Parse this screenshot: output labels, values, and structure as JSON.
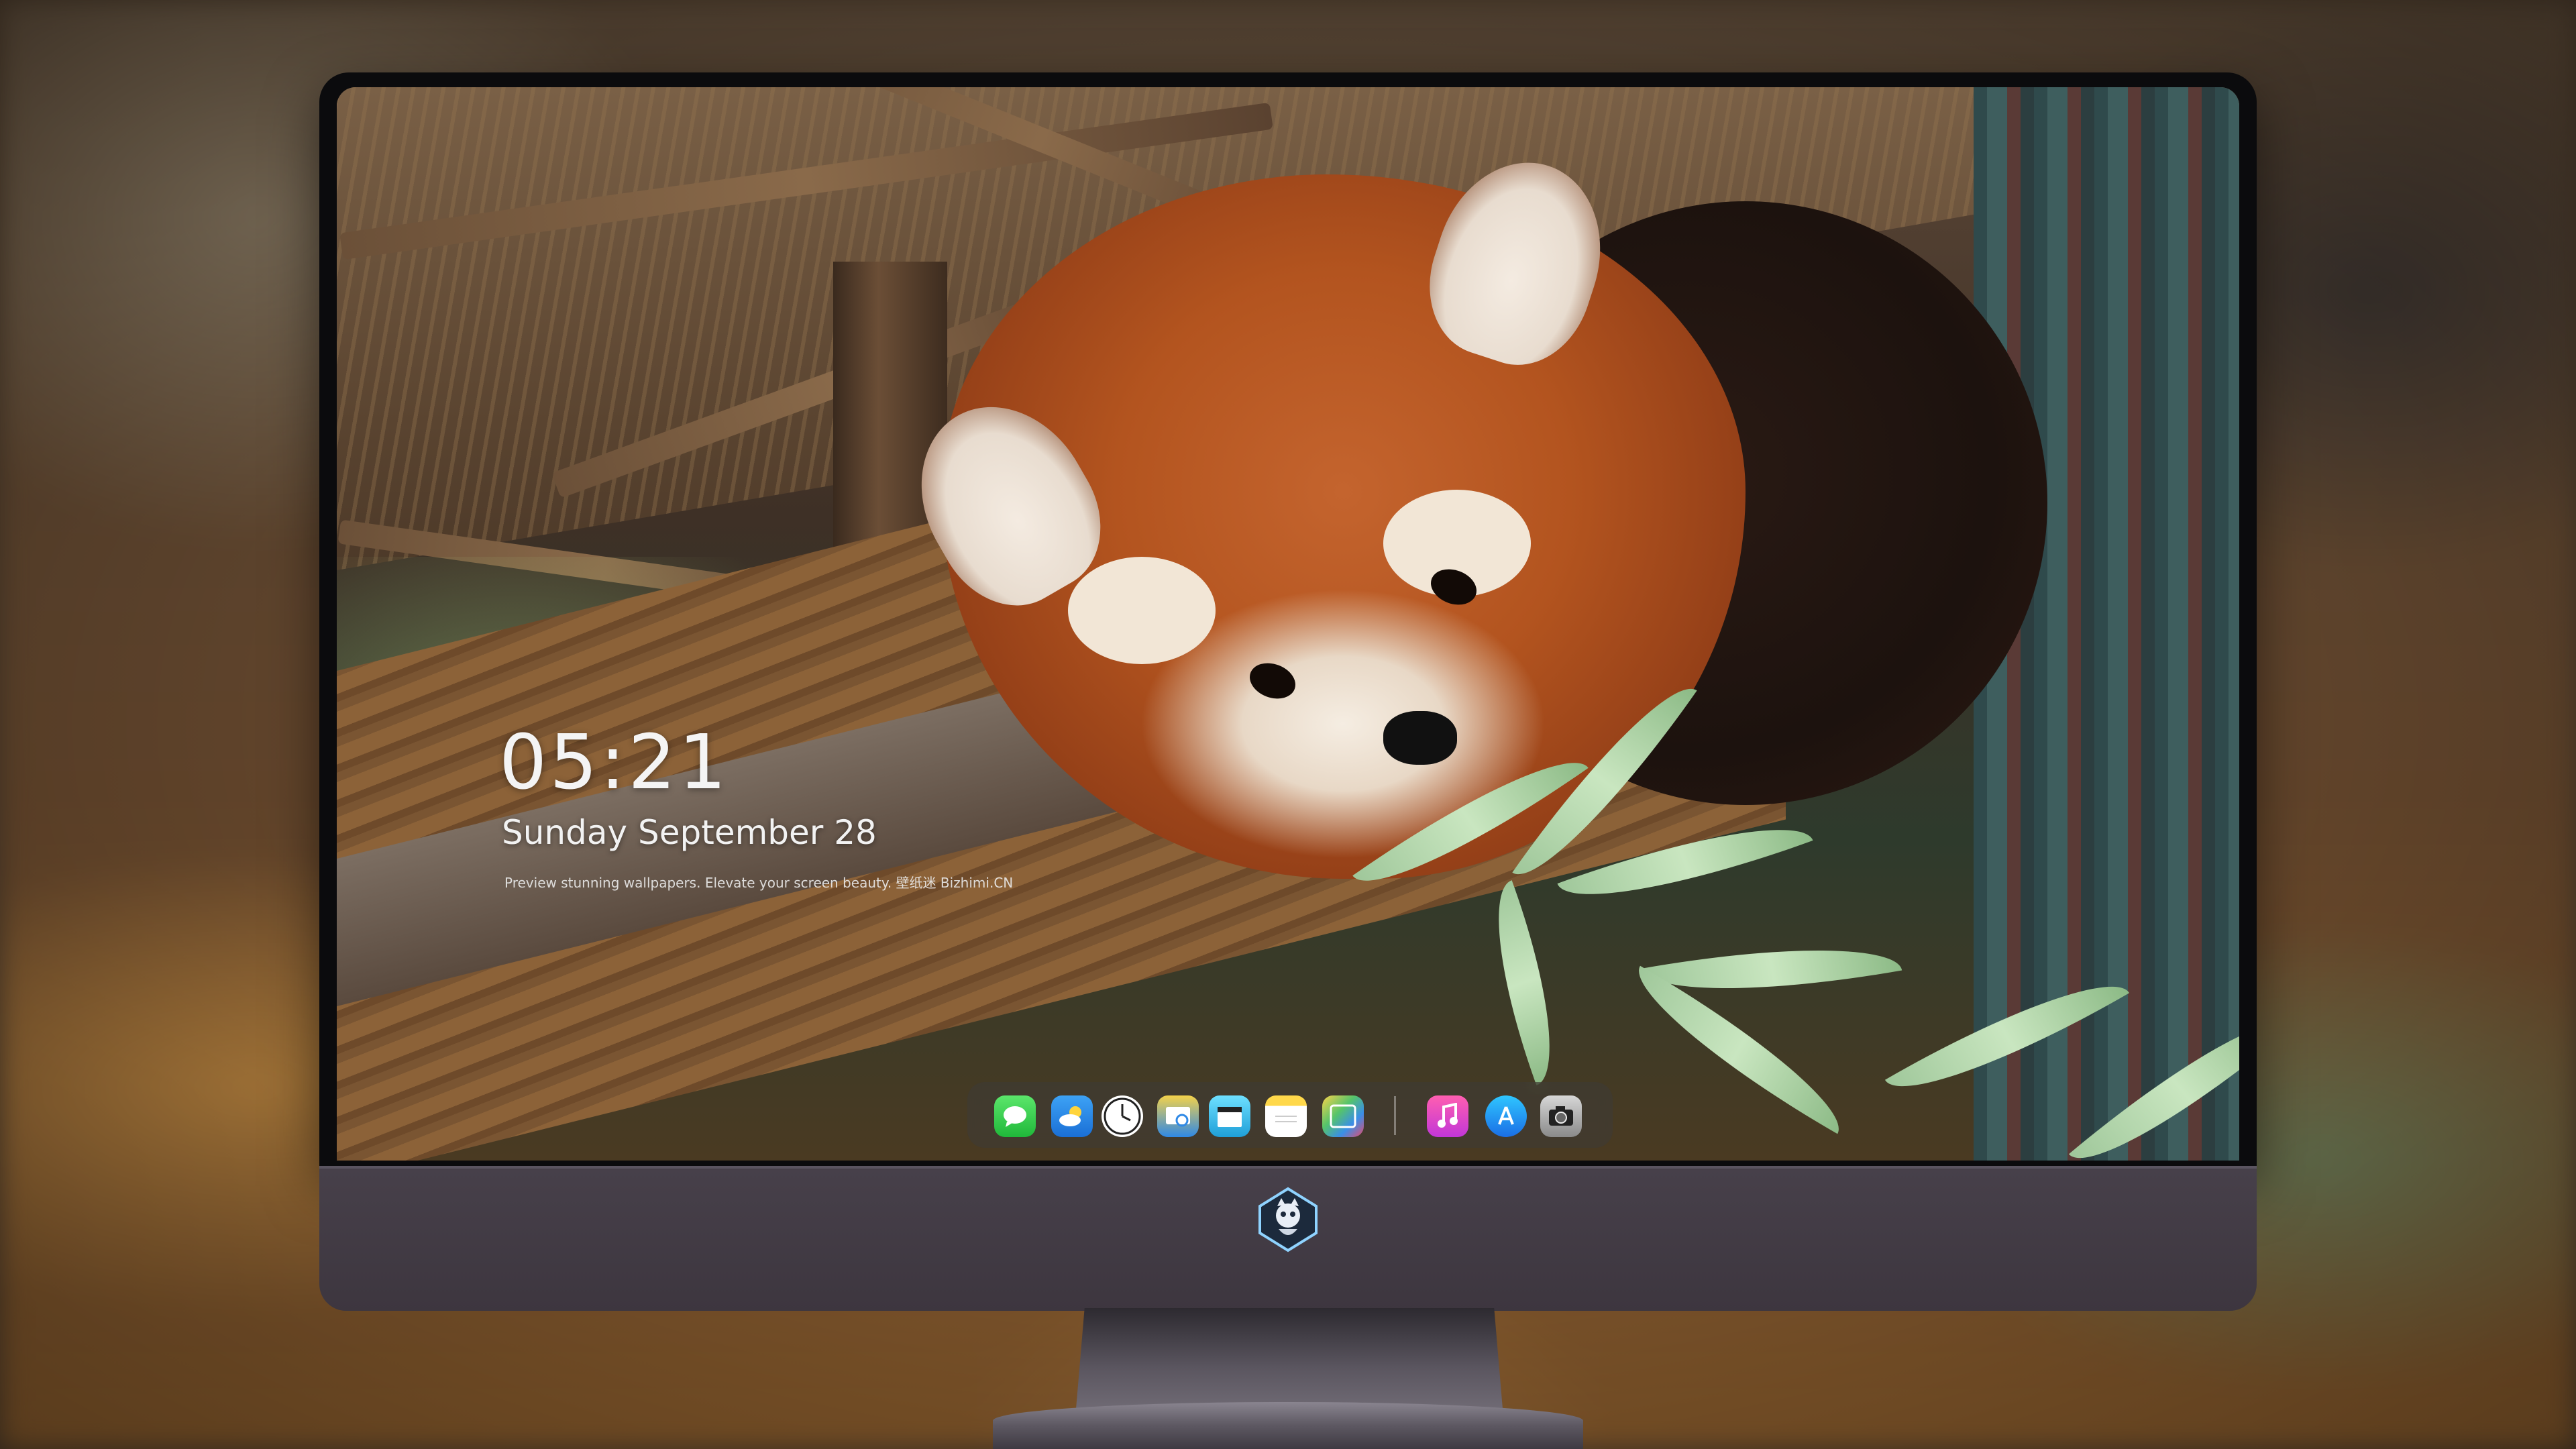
{
  "lockscreen": {
    "time": "05:21",
    "date": "Sunday  September  28",
    "slogan": "Preview stunning wallpapers. Elevate your screen beauty. 壁纸迷   Bizhimi.CN"
  },
  "dock": {
    "apps": [
      {
        "name": "Messages",
        "icon": "message-bubble-icon"
      },
      {
        "name": "Weather",
        "icon": "cloud-sun-icon"
      },
      {
        "name": "Clock",
        "icon": "clock-icon"
      },
      {
        "name": "Preview",
        "icon": "preview-icon"
      },
      {
        "name": "Clips",
        "icon": "clapperboard-icon"
      },
      {
        "name": "Notes",
        "icon": "notes-icon"
      },
      {
        "name": "Photos",
        "icon": "photos-icon"
      },
      {
        "name": "Music",
        "icon": "music-note-icon"
      },
      {
        "name": "App Store",
        "icon": "app-store-icon"
      },
      {
        "name": "Camera",
        "icon": "camera-icon"
      }
    ]
  },
  "colors": {
    "bezel": "#0b0b0d",
    "chin": "#433c46",
    "dock_bg": "rgba(60,60,60,0.45)"
  }
}
